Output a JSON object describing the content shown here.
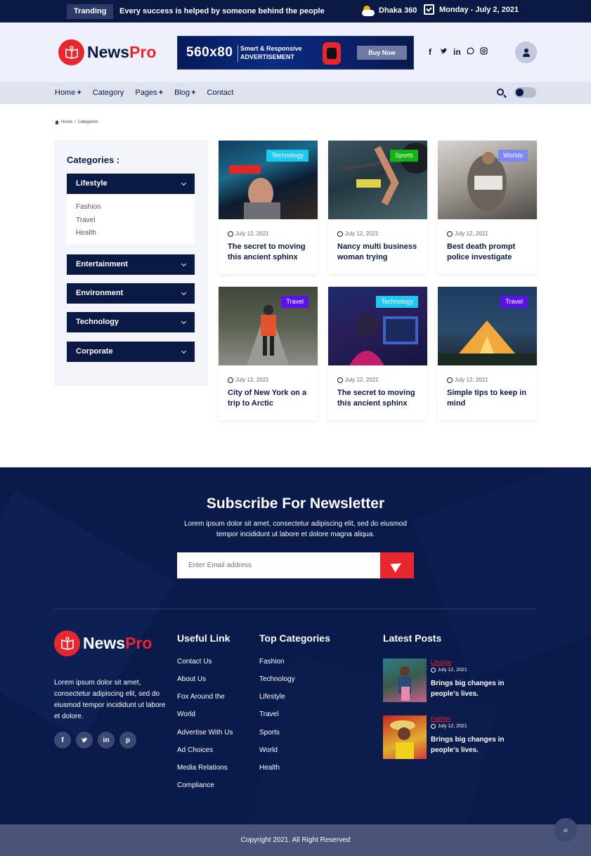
{
  "topbar": {
    "trending_label": "Tranding",
    "trending_text": "Every success is helped by someone behind the people",
    "weather": "Dhaka 360",
    "date": "Monday - July 2, 2021"
  },
  "header": {
    "logo_part1": "News",
    "logo_part2": "Pro",
    "ad": {
      "size": "560x80",
      "line1": "Smart & Responsive",
      "line2": "ADVERTISEMENT",
      "button": "Buy Now"
    },
    "socials": [
      "f",
      "t",
      "in",
      "w",
      "ig"
    ]
  },
  "nav": {
    "items": [
      {
        "label": "Home",
        "plus": "+"
      },
      {
        "label": "Category",
        "plus": ""
      },
      {
        "label": "Pages",
        "plus": "+"
      },
      {
        "label": "Blog",
        "plus": "+"
      },
      {
        "label": "Contact",
        "plus": ""
      }
    ]
  },
  "breadcrumb": {
    "home": "Home",
    "sep": "/",
    "current": "Categories"
  },
  "sidebar": {
    "title": "Categories :",
    "categories": [
      "Lifestyle",
      "Entertainment",
      "Environment",
      "Technology",
      "Corporate"
    ],
    "lifestyle_sub": [
      "Fashion",
      "Travel",
      "Health"
    ]
  },
  "posts": [
    {
      "tag": "Technology",
      "tag_color": "#1ec8f0",
      "date": "July 12, 2021",
      "title": "The secret to moving this ancient sphinx"
    },
    {
      "tag": "Sports",
      "tag_color": "#12b312",
      "date": "July 12, 2021",
      "title": "Nancy multi business woman trying"
    },
    {
      "tag": "Worlds",
      "tag_color": "#7f86f5",
      "date": "July 12, 2021",
      "title": "Best death prompt police investigate"
    },
    {
      "tag": "Travel",
      "tag_color": "#5a12e8",
      "date": "July 12, 2021",
      "title": "City of New York on a trip to Arctic"
    },
    {
      "tag": "Technology",
      "tag_color": "#1ec8f0",
      "date": "July 12, 2021",
      "title": "The secret to moving this ancient sphinx"
    },
    {
      "tag": "Travel",
      "tag_color": "#5a12e8",
      "date": "July 12, 2021",
      "title": "Simple tips to keep in mind"
    }
  ],
  "newsletter": {
    "title": "Subscribe For Newsletter",
    "text": "Lorem ipsum dolor sit amet, consectetur adipiscing elit, sed do eiusmod tempor incididunt ut labore et dolore magna aliqua.",
    "placeholder": "Enter Email address"
  },
  "footer": {
    "about": "Lorem ipsum dolor sit amet, consectetur adipiscing elit, sed do eiusmod tempor incididunt ut labore et dolore.",
    "socials": [
      "f",
      "t",
      "in",
      "p"
    ],
    "useful_title": "Useful Link",
    "useful_links": [
      "Contact Us",
      "About Us",
      "Fox Around the",
      "World",
      "Advertise With Us",
      "Ad Choices",
      "Media Relations",
      "Compliance"
    ],
    "top_title": "Top Categories",
    "top_links": [
      "Fashion",
      "Technology",
      "Lifestyle",
      "Travel",
      "Sports",
      "World",
      "Health"
    ],
    "latest_title": "Latest Posts",
    "latest": [
      {
        "category": "Lifestyle",
        "date": "July 12, 2021",
        "title": "Brings big changes in people's lives."
      },
      {
        "category": "Fashion",
        "date": "July 12, 2021",
        "title": "Brings big changes in people's lives."
      }
    ],
    "copyright": "Copyright 2021. All Right Reserved",
    "scroll_top": "«"
  },
  "colors": {
    "brand_navy": "#0b1a45",
    "brand_red": "#e8262d"
  }
}
